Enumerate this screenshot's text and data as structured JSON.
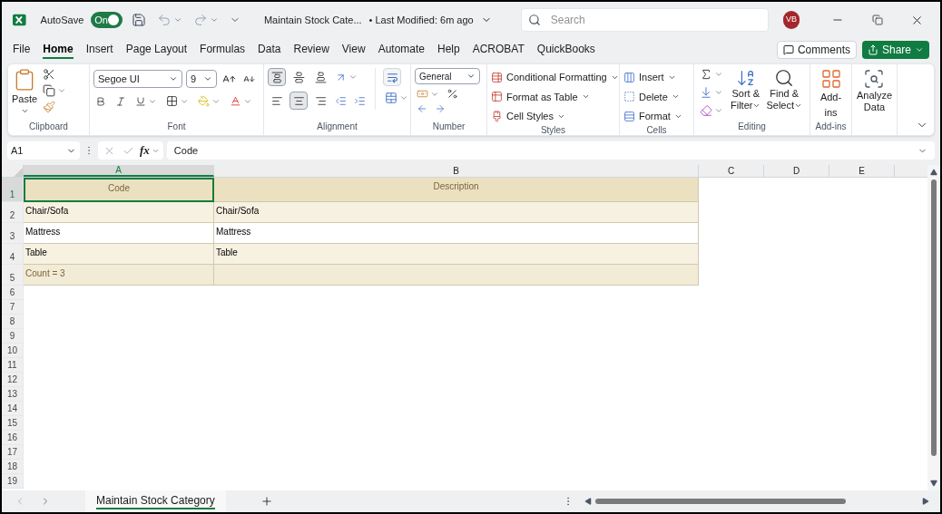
{
  "title_bar": {
    "autosave": {
      "label": "AutoSave",
      "on": true,
      "state_label": "On"
    },
    "document_title": "Maintain Stock Cate...",
    "last_modified": "• Last Modified: 6m ago",
    "search": {
      "placeholder": "Search"
    },
    "avatar": "VB"
  },
  "menu_tabs": [
    {
      "label": "File",
      "selected": false
    },
    {
      "label": "Home",
      "selected": true
    },
    {
      "label": "Insert",
      "selected": false
    },
    {
      "label": "Page Layout",
      "selected": false
    },
    {
      "label": "Formulas",
      "selected": false
    },
    {
      "label": "Data",
      "selected": false
    },
    {
      "label": "Review",
      "selected": false
    },
    {
      "label": "View",
      "selected": false
    },
    {
      "label": "Automate",
      "selected": false
    },
    {
      "label": "Help",
      "selected": false
    },
    {
      "label": "ACROBAT",
      "selected": false
    },
    {
      "label": "QuickBooks",
      "selected": false
    }
  ],
  "comments_button": "Comments",
  "share_button": "Share",
  "ribbon": {
    "clipboard": {
      "label": "Clipboard",
      "paste": "Paste"
    },
    "font": {
      "label": "Font",
      "font_name": "Segoe UI",
      "font_size": "9"
    },
    "alignment": {
      "label": "Alignment",
      "vertical": [
        {
          "kind": "top",
          "selected": true
        },
        {
          "kind": "middle",
          "selected": false
        },
        {
          "kind": "bottom",
          "selected": false
        }
      ],
      "horizontal": [
        {
          "kind": "left",
          "selected": false
        },
        {
          "kind": "center",
          "selected": true
        },
        {
          "kind": "right",
          "selected": false
        }
      ]
    },
    "number": {
      "label": "Number",
      "format": "General"
    },
    "styles": {
      "label": "Styles",
      "items": [
        "Conditional Formatting",
        "Format as Table",
        "Cell Styles"
      ]
    },
    "cells": {
      "label": "Cells",
      "items": [
        "Insert",
        "Delete",
        "Format"
      ]
    },
    "editing": {
      "label": "Editing",
      "sort": [
        "Sort &",
        "Filter"
      ],
      "find": [
        "Find &",
        "Select"
      ]
    },
    "add_ins": {
      "label": "Add-ins",
      "button": "Add-ins"
    },
    "analyze": {
      "button": [
        "Analyze",
        "Data"
      ]
    }
  },
  "formula_bar": {
    "name_box": "A1",
    "function_label": "fx",
    "formula": "Code"
  },
  "sheet": {
    "columns": [
      {
        "label": "A",
        "selected": true
      },
      {
        "label": "B",
        "selected": false
      },
      {
        "label": "C",
        "selected": false
      },
      {
        "label": "D",
        "selected": false
      },
      {
        "label": "E",
        "selected": false
      }
    ],
    "rows": [
      {
        "number": "1",
        "kind": "header",
        "selected": true,
        "cells": [
          "Code",
          "Description"
        ]
      },
      {
        "number": "2",
        "kind": "data",
        "selected": false,
        "banded": true,
        "cells": [
          "Chair/Sofa",
          "Chair/Sofa"
        ]
      },
      {
        "number": "3",
        "kind": "data",
        "selected": false,
        "banded": false,
        "cells": [
          "Mattress",
          "Mattress"
        ]
      },
      {
        "number": "4",
        "kind": "data",
        "selected": false,
        "banded": true,
        "cells": [
          "Table",
          "Table"
        ]
      },
      {
        "number": "5",
        "kind": "total",
        "selected": false,
        "cells": [
          "Count = 3"
        ]
      },
      {
        "number": "6",
        "kind": "empty",
        "selected": false
      },
      {
        "number": "7",
        "kind": "empty",
        "selected": false
      },
      {
        "number": "8",
        "kind": "empty",
        "selected": false
      },
      {
        "number": "9",
        "kind": "empty",
        "selected": false
      },
      {
        "number": "10",
        "kind": "empty",
        "selected": false
      },
      {
        "number": "11",
        "kind": "empty",
        "selected": false
      },
      {
        "number": "12",
        "kind": "empty",
        "selected": false
      },
      {
        "number": "13",
        "kind": "empty",
        "selected": false
      },
      {
        "number": "14",
        "kind": "empty",
        "selected": false
      },
      {
        "number": "15",
        "kind": "empty",
        "selected": false
      },
      {
        "number": "16",
        "kind": "empty",
        "selected": false
      },
      {
        "number": "17",
        "kind": "empty",
        "selected": false
      },
      {
        "number": "18",
        "kind": "empty",
        "selected": false
      },
      {
        "number": "19",
        "kind": "empty",
        "selected": false
      }
    ]
  },
  "sheet_tabs": [
    {
      "label": "Maintain Stock Category",
      "selected": true
    }
  ]
}
